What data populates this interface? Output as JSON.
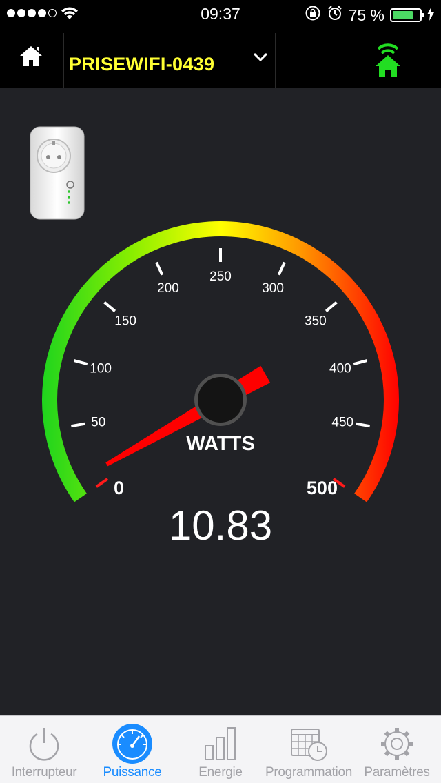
{
  "status_bar": {
    "time": "09:37",
    "battery_percent": "75 %",
    "signal_bars_filled": 4,
    "signal_bars_total": 5,
    "battery_level": 0.75
  },
  "header": {
    "device_name": "PRISEWIFI-0439",
    "connection_color": "#22dd22"
  },
  "gauge": {
    "min": 0,
    "max": 500,
    "tick_labels": [
      "0",
      "50",
      "100",
      "150",
      "200",
      "250",
      "300",
      "350",
      "400",
      "450",
      "500"
    ],
    "unit": "WATTS",
    "value_display": "10.83",
    "value": 10.83
  },
  "tabs": [
    {
      "label": "Interrupteur",
      "icon": "power-icon",
      "active": false
    },
    {
      "label": "Puissance",
      "icon": "speedometer-icon",
      "active": true
    },
    {
      "label": "Energie",
      "icon": "bar-chart-icon",
      "active": false
    },
    {
      "label": "Programmation",
      "icon": "calendar-clock-icon",
      "active": false
    },
    {
      "label": "Paramètres",
      "icon": "gear-icon",
      "active": false
    }
  ],
  "colors": {
    "active_tab": "#1a8cff",
    "inactive_tab": "#a3a3a8",
    "title": "#ffff33",
    "needle": "#ff0000",
    "background": "#212226"
  }
}
